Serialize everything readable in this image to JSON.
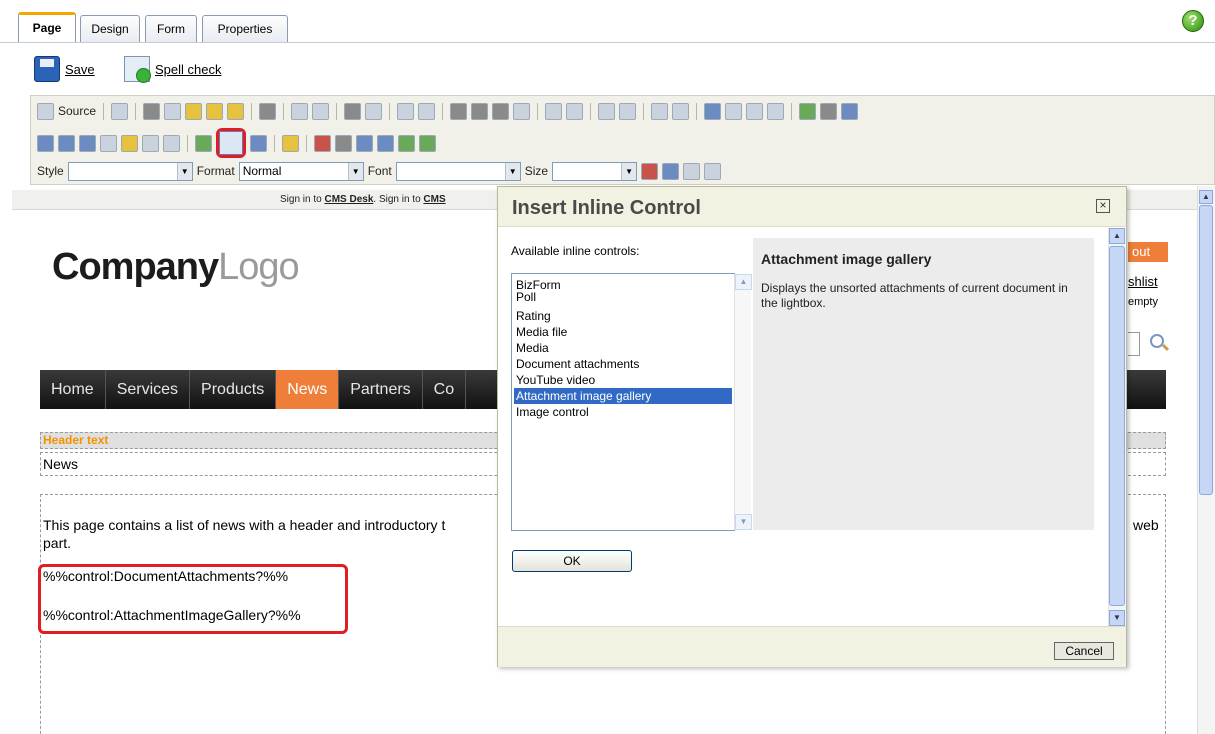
{
  "tabs": [
    {
      "label": "Page"
    },
    {
      "label": "Design"
    },
    {
      "label": "Form"
    },
    {
      "label": "Properties"
    }
  ],
  "help_icon": "?",
  "actions": {
    "save_label": "Save",
    "spellcheck_label": "Spell check"
  },
  "toolbar": {
    "source_label": "Source",
    "style_label": "Style",
    "style_value": "",
    "format_label": "Format",
    "format_value": "Normal",
    "font_label": "Font",
    "font_value": "",
    "size_label": "Size",
    "size_value": ""
  },
  "page": {
    "signin_pre": "Sign in to ",
    "signin_link1": "CMS Desk",
    "signin_mid": ". Sign in to ",
    "signin_link2": "CMS",
    "logo_dark": "Company",
    "logo_light": "Logo",
    "nav": [
      "Home",
      "Services",
      "Products",
      "News",
      "Partners",
      "Co"
    ],
    "nav_active_index": 3,
    "header_label": "Header text",
    "header_value": "News",
    "content_line1": "This page contains a list of news with a header and introductory t",
    "content_line1_tail": "web",
    "content_line2": "part.",
    "control1": "%%control:DocumentAttachments?%%",
    "control2": "%%control:AttachmentImageGallery?%%",
    "right_button": "out",
    "right_link": "shlist",
    "right_small": "empty"
  },
  "dialog": {
    "title": "Insert Inline Control",
    "available_label": "Available inline controls:",
    "controls": [
      "BizForm",
      "Poll",
      "Rating",
      "Media file",
      "Media",
      "Document attachments",
      "YouTube video",
      "Attachment image gallery",
      "Image control"
    ],
    "selected_index": 7,
    "desc_title": "Attachment image gallery",
    "desc_text": "Displays the unsorted attachments of current document in the lightbox.",
    "ok_label": "OK",
    "cancel_label": "Cancel"
  }
}
